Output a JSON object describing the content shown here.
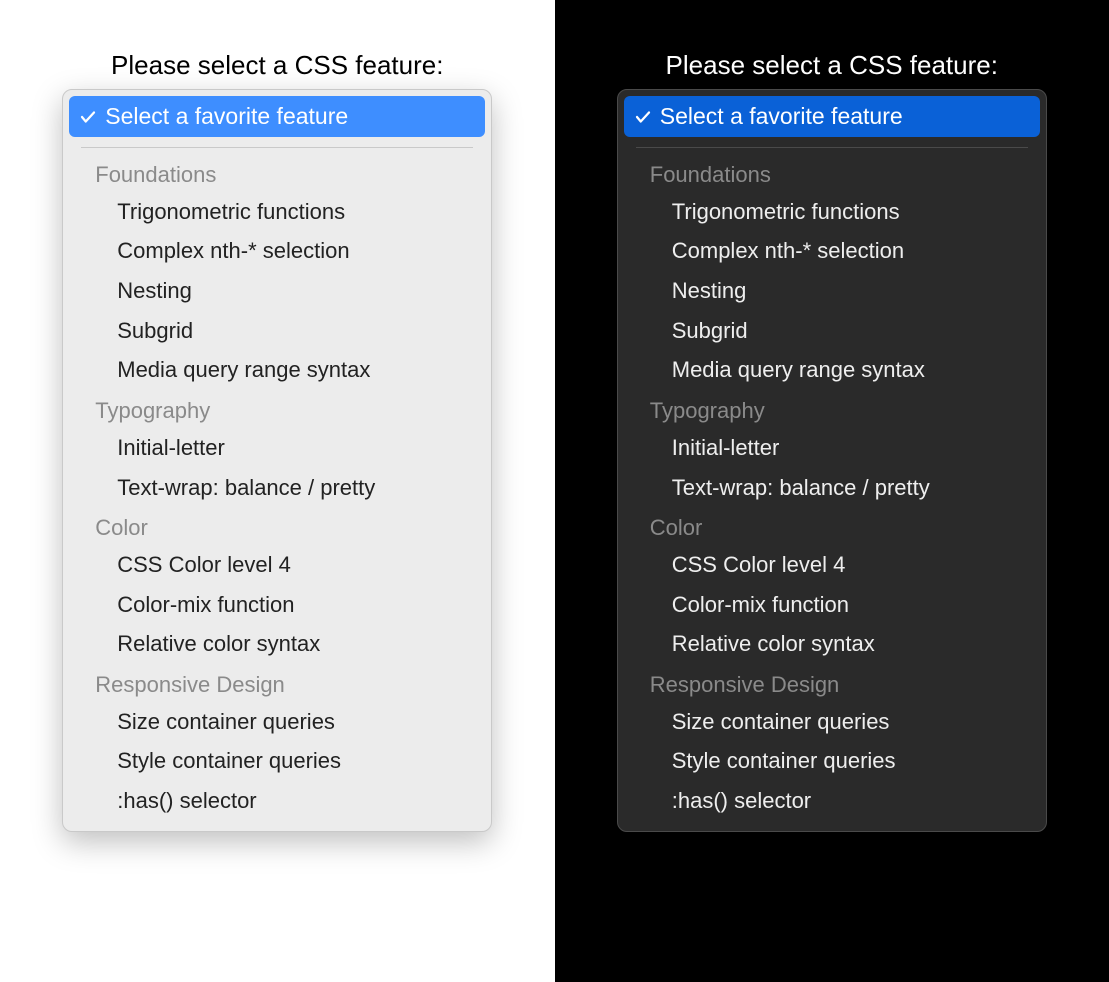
{
  "prompt": "Please select a CSS feature:",
  "selected_label": "Select a favorite feature",
  "groups": [
    {
      "label": "Foundations",
      "options": [
        "Trigonometric functions",
        "Complex nth-* selection",
        "Nesting",
        "Subgrid",
        "Media query range syntax"
      ]
    },
    {
      "label": "Typography",
      "options": [
        "Initial-letter",
        "Text-wrap: balance / pretty"
      ]
    },
    {
      "label": "Color",
      "options": [
        "CSS Color level 4",
        "Color-mix function",
        "Relative color syntax"
      ]
    },
    {
      "label": "Responsive Design",
      "options": [
        "Size container queries",
        "Style container queries",
        ":has() selector"
      ]
    }
  ],
  "colors": {
    "light_accent": "#3e8eff",
    "dark_accent": "#0a61d7"
  }
}
